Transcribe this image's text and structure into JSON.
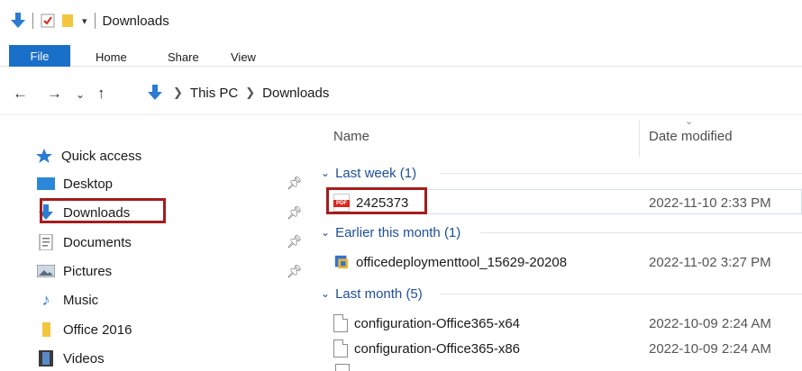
{
  "window": {
    "title": "Downloads"
  },
  "ribbon": {
    "tabs": [
      "File",
      "Home",
      "Share",
      "View"
    ]
  },
  "address": {
    "crumbs": [
      "This PC",
      "Downloads"
    ]
  },
  "nav_pane": {
    "quick_access": "Quick access",
    "items": [
      {
        "label": "Desktop",
        "icon": "desktop-icon",
        "pinned": true
      },
      {
        "label": "Downloads",
        "icon": "downloads-icon",
        "pinned": true,
        "highlighted": true
      },
      {
        "label": "Documents",
        "icon": "documents-icon",
        "pinned": true
      },
      {
        "label": "Pictures",
        "icon": "pictures-icon",
        "pinned": true
      },
      {
        "label": "Music",
        "icon": "music-icon",
        "pinned": false
      },
      {
        "label": "Office 2016",
        "icon": "folder-icon",
        "pinned": false
      },
      {
        "label": "Videos",
        "icon": "videos-icon",
        "pinned": false
      }
    ]
  },
  "file_list": {
    "columns": {
      "name": "Name",
      "date": "Date modified"
    },
    "groups": [
      {
        "label": "Last week (1)",
        "files": [
          {
            "name": "2425373",
            "date": "2022-11-10 2:33 PM",
            "icon": "pdf-icon",
            "highlighted": true
          }
        ]
      },
      {
        "label": "Earlier this month (1)",
        "files": [
          {
            "name": "officedeploymenttool_15629-20208",
            "date": "2022-11-02 3:27 PM",
            "icon": "installer-icon"
          }
        ]
      },
      {
        "label": "Last month (5)",
        "files": [
          {
            "name": "configuration-Office365-x64",
            "date": "2022-10-09 2:24 AM",
            "icon": "document-icon"
          },
          {
            "name": "configuration-Office365-x86",
            "date": "2022-10-09 2:24 AM",
            "icon": "document-icon"
          }
        ]
      }
    ]
  },
  "colors": {
    "accent": "#1a6fc8",
    "highlight_box": "#a61c1c",
    "group_text": "#1e4e9a"
  }
}
